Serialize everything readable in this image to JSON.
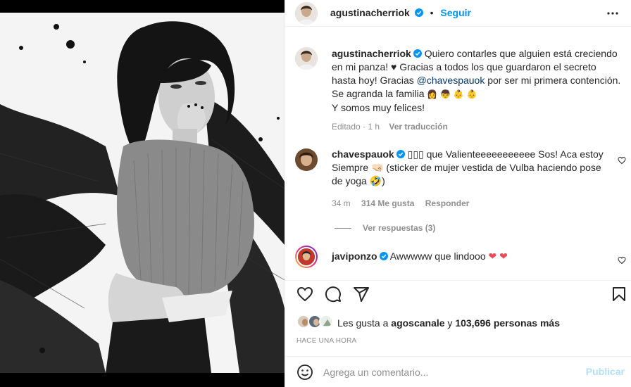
{
  "post": {
    "author": "agustinacherriok",
    "follow_label": "Seguir",
    "caption_parts": {
      "p1": "Quiero contarles que alguien está creciendo",
      "p2": "en mi panza! ♥ Gracias a todos los que guardaron el secreto",
      "p3": "hasta hoy! Gracias ",
      "mention": "@chavespauok",
      "p4": " por ser mi primera contención.",
      "p5": "Se agranda la familia ",
      "p5_emoji": "👩 👦 👶 👶",
      "p6": "Y somos muy felices!"
    },
    "edited_label": "Editado",
    "caption_time": "1 h",
    "translate_label": "Ver traducción"
  },
  "comments": [
    {
      "user": "chavespauok",
      "lines": [
        "▯▯▯ que Valienteeeeeeeeeee Sos! Aca estoy",
        "Siempre 🤜🏻 (sticker de mujer vestida de Vulba haciendo pose",
        "de yoga 🤣)"
      ],
      "time": "34 m",
      "likes": "314 Me gusta",
      "reply_label": "Responder",
      "see_replies": "Ver respuestas (3)"
    },
    {
      "user": "javiponzo",
      "text": "Awwwww que lindooo",
      "hearts": "❤ ❤"
    }
  ],
  "likes": {
    "prefix": "Les gusta a ",
    "user": "agoscanale",
    "middle": " y ",
    "count": "103,696 personas más"
  },
  "time_ago": "HACE UNA HORA",
  "composer": {
    "placeholder": "Agrega un comentario...",
    "publish_label": "Publicar"
  },
  "colors": {
    "accent": "#0095f6",
    "verified": "#0095f6",
    "heart_red": "#ed4956",
    "publish_disabled": "#b2dffc"
  },
  "icons": [
    "more-options-icon",
    "heart-icon",
    "comment-icon",
    "share-icon",
    "save-icon",
    "emoji-icon",
    "verified-icon"
  ]
}
